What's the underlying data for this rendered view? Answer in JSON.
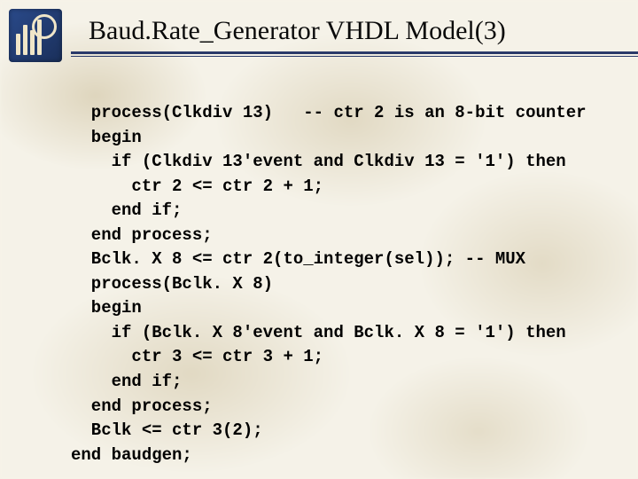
{
  "title": "Baud.Rate_Generator VHDL Model(3)",
  "logo": {
    "name": "institution-logo"
  },
  "code": {
    "lines": [
      "  process(Clkdiv 13)   -- ctr 2 is an 8-bit counter",
      "  begin",
      "    if (Clkdiv 13'event and Clkdiv 13 = '1') then",
      "      ctr 2 <= ctr 2 + 1;",
      "    end if;",
      "  end process;",
      "  Bclk. X 8 <= ctr 2(to_integer(sel)); -- MUX",
      "  process(Bclk. X 8)",
      "  begin",
      "    if (Bclk. X 8'event and Bclk. X 8 = '1') then",
      "      ctr 3 <= ctr 3 + 1;",
      "    end if;",
      "  end process;",
      "  Bclk <= ctr 3(2);",
      "end baudgen;"
    ]
  }
}
